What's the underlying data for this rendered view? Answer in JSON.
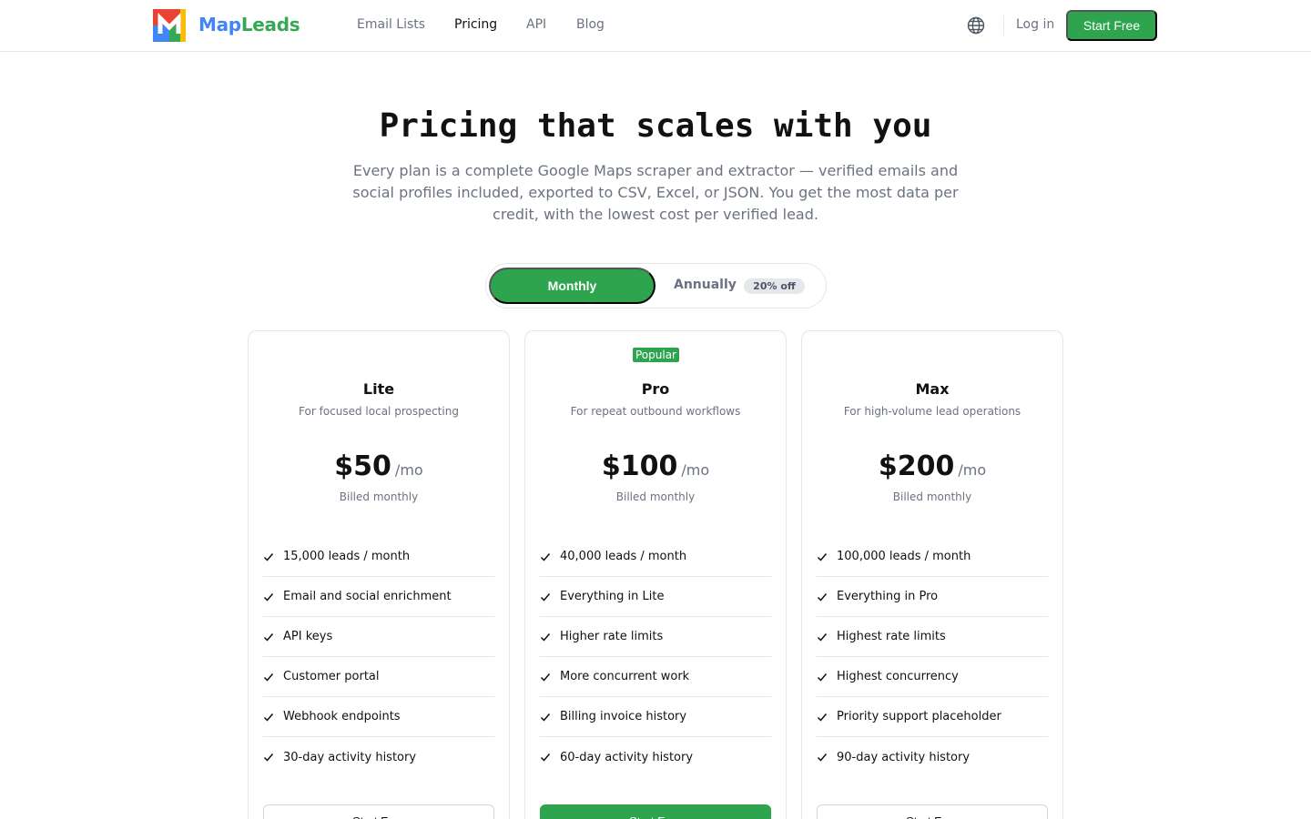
{
  "header": {
    "brand_part1": "Map",
    "brand_part2": "Leads",
    "nav": [
      "Email Lists",
      "Pricing",
      "API",
      "Blog"
    ],
    "active_nav": "Pricing",
    "login": "Log in",
    "start_free": "Start Free"
  },
  "hero": {
    "title": "Pricing that scales with you",
    "subtitle": "Every plan is a complete Google Maps scraper and extractor — verified emails and social profiles included, exported to CSV, Excel, or JSON. You get the most data per credit, with the lowest cost per verified lead."
  },
  "billing_toggle": {
    "monthly": "Monthly",
    "annually": "Annually",
    "discount_badge": "20% off",
    "selected": "Monthly"
  },
  "plans": [
    {
      "name": "Lite",
      "description": "For focused local prospecting",
      "price": "$50",
      "period": "/mo",
      "billing": "Billed monthly",
      "features": [
        "15,000 leads / month",
        "Email and social enrichment",
        "API keys",
        "Customer portal",
        "Webhook endpoints",
        "30-day activity history"
      ],
      "cta": "Start Free"
    },
    {
      "name": "Pro",
      "badge": "Popular",
      "description": "For repeat outbound workflows",
      "price": "$100",
      "period": "/mo",
      "billing": "Billed monthly",
      "features": [
        "40,000 leads / month",
        "Everything in Lite",
        "Higher rate limits",
        "More concurrent work",
        "Billing invoice history",
        "60-day activity history"
      ],
      "cta": "Start Free"
    },
    {
      "name": "Max",
      "description": "For high-volume lead operations",
      "price": "$200",
      "period": "/mo",
      "billing": "Billed monthly",
      "features": [
        "100,000 leads / month",
        "Everything in Pro",
        "Highest rate limits",
        "Highest concurrency",
        "Priority support placeholder",
        "90-day activity history"
      ],
      "cta": "Start Free"
    }
  ],
  "colors": {
    "accent": "#2ea44f",
    "brand_blue": "#4285f4",
    "brand_green": "#34a853",
    "muted_text": "#6b7280",
    "border": "#e5e7eb"
  },
  "icons": [
    "mapleads-logo-icon",
    "globe-icon",
    "check-icon"
  ]
}
